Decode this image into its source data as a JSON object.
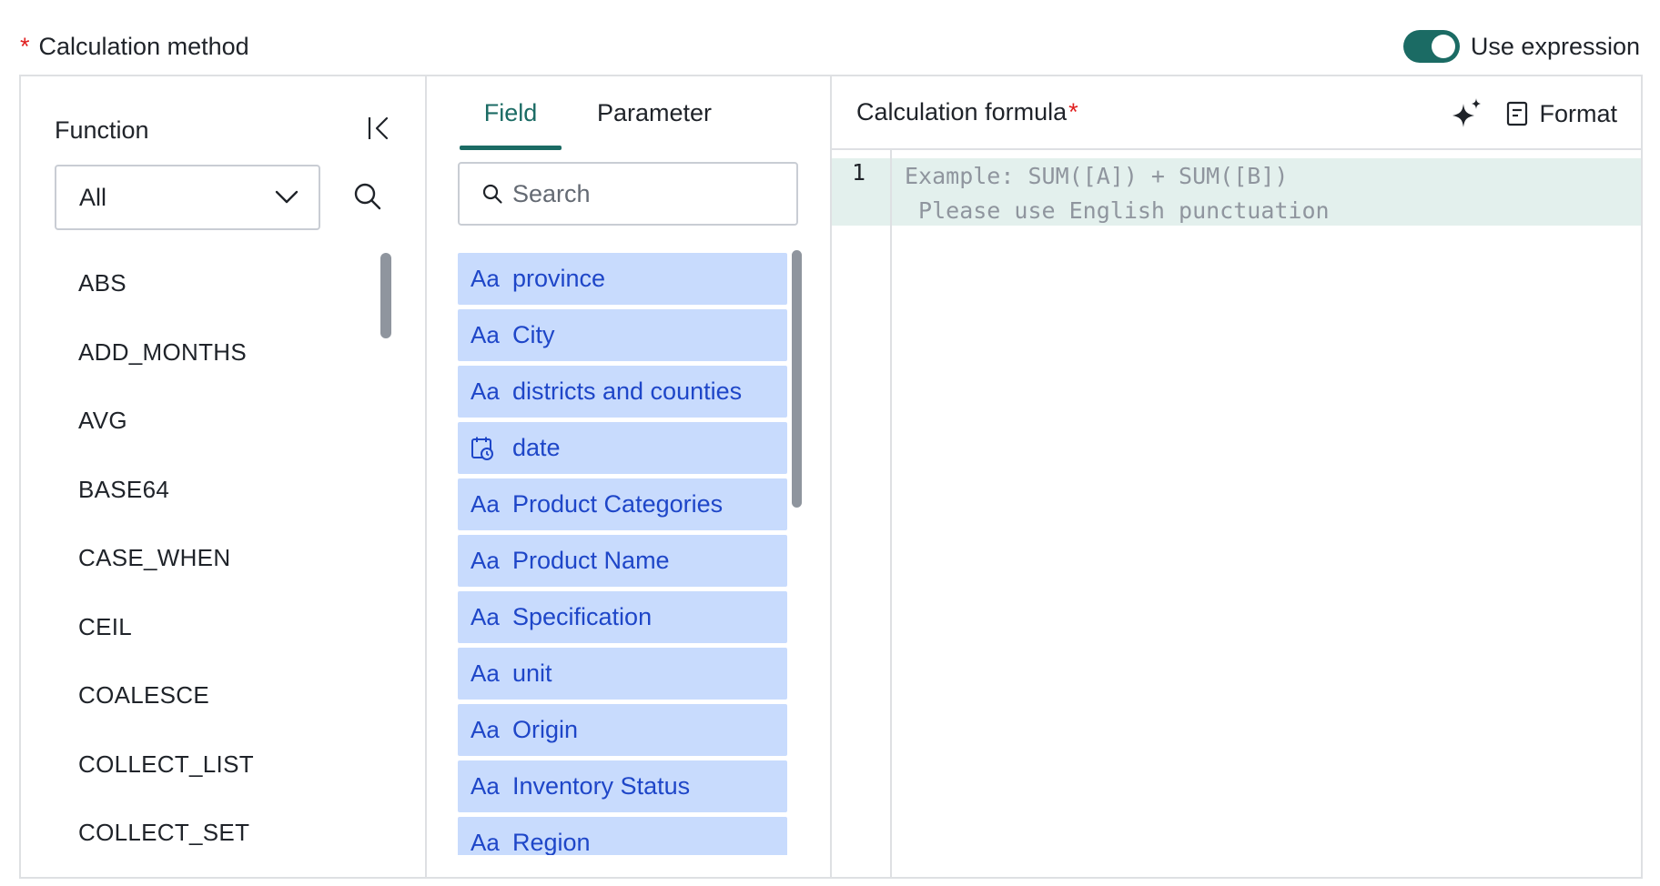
{
  "header": {
    "required_mark": "*",
    "label": "Calculation method",
    "toggle_label": "Use expression",
    "toggle_on": true,
    "toggle_color": "#1b6b64"
  },
  "function_panel": {
    "title": "Function",
    "collapse_icon": "collapse-left-icon",
    "select_value": "All",
    "search_icon": "search-icon",
    "items": [
      "ABS",
      "ADD_MONTHS",
      "AVG",
      "BASE64",
      "CASE_WHEN",
      "CEIL",
      "COALESCE",
      "COLLECT_LIST",
      "COLLECT_SET"
    ]
  },
  "field_panel": {
    "tabs": [
      "Field",
      "Parameter"
    ],
    "active_tab": "Field",
    "active_tab_color": "#1b6b64",
    "search_placeholder": "Search",
    "field_bg_color": "#c8dbfd",
    "field_text_color": "#1e46c8",
    "fields": [
      {
        "icon": "text-type-icon",
        "glyph": "Aa",
        "label": "province"
      },
      {
        "icon": "text-type-icon",
        "glyph": "Aa",
        "label": "City"
      },
      {
        "icon": "text-type-icon",
        "glyph": "Aa",
        "label": "districts and counties"
      },
      {
        "icon": "date-type-icon",
        "glyph": "",
        "label": "date"
      },
      {
        "icon": "text-type-icon",
        "glyph": "Aa",
        "label": "Product Categories"
      },
      {
        "icon": "text-type-icon",
        "glyph": "Aa",
        "label": "Product Name"
      },
      {
        "icon": "text-type-icon",
        "glyph": "Aa",
        "label": "Specification"
      },
      {
        "icon": "text-type-icon",
        "glyph": "Aa",
        "label": "unit"
      },
      {
        "icon": "text-type-icon",
        "glyph": "Aa",
        "label": "Origin"
      },
      {
        "icon": "text-type-icon",
        "glyph": "Aa",
        "label": "Inventory Status"
      },
      {
        "icon": "text-type-icon",
        "glyph": "Aa",
        "label": "Region"
      }
    ]
  },
  "formula_panel": {
    "title": "Calculation formula",
    "required_mark": "*",
    "ai_icon": "sparkle-icon",
    "format_icon": "document-icon",
    "format_label": "Format",
    "line_number": "1",
    "placeholder_line1": "Example: SUM([A]) + SUM([B])",
    "placeholder_line2": " Please use English punctuation"
  }
}
